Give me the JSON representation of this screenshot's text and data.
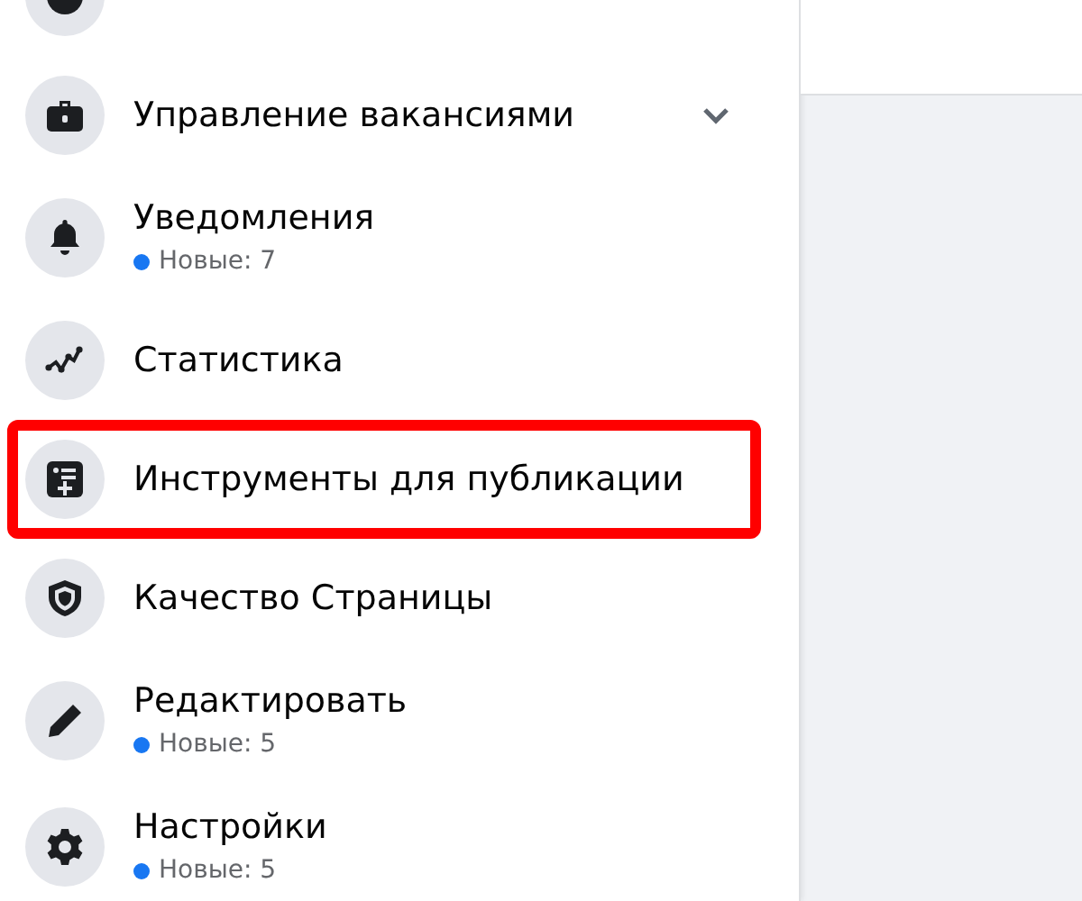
{
  "sidebar": {
    "items": [
      {
        "kind": "info",
        "expandable": false,
        "highlighted": false
      },
      {
        "kind": "briefcase",
        "label": "Управление вакансиями",
        "expandable": true,
        "highlighted": false
      },
      {
        "kind": "bell",
        "label": "Уведомления",
        "expandable": false,
        "highlighted": false,
        "badge": {
          "text": "Новые: 7",
          "color": "#1877f2"
        }
      },
      {
        "kind": "stats",
        "label": "Статистика",
        "expandable": false,
        "highlighted": false
      },
      {
        "kind": "publish",
        "label": "Инструменты для публикации",
        "expandable": false,
        "highlighted": true
      },
      {
        "kind": "shield",
        "label": "Качество Страницы",
        "expandable": false,
        "highlighted": false
      },
      {
        "kind": "pencil",
        "label": "Редактировать",
        "expandable": false,
        "highlighted": false,
        "badge": {
          "text": "Новые: 5",
          "color": "#1877f2"
        }
      },
      {
        "kind": "gear",
        "label": "Настройки",
        "expandable": false,
        "highlighted": false,
        "badge": {
          "text": "Новые: 5",
          "color": "#1877f2"
        }
      }
    ]
  }
}
